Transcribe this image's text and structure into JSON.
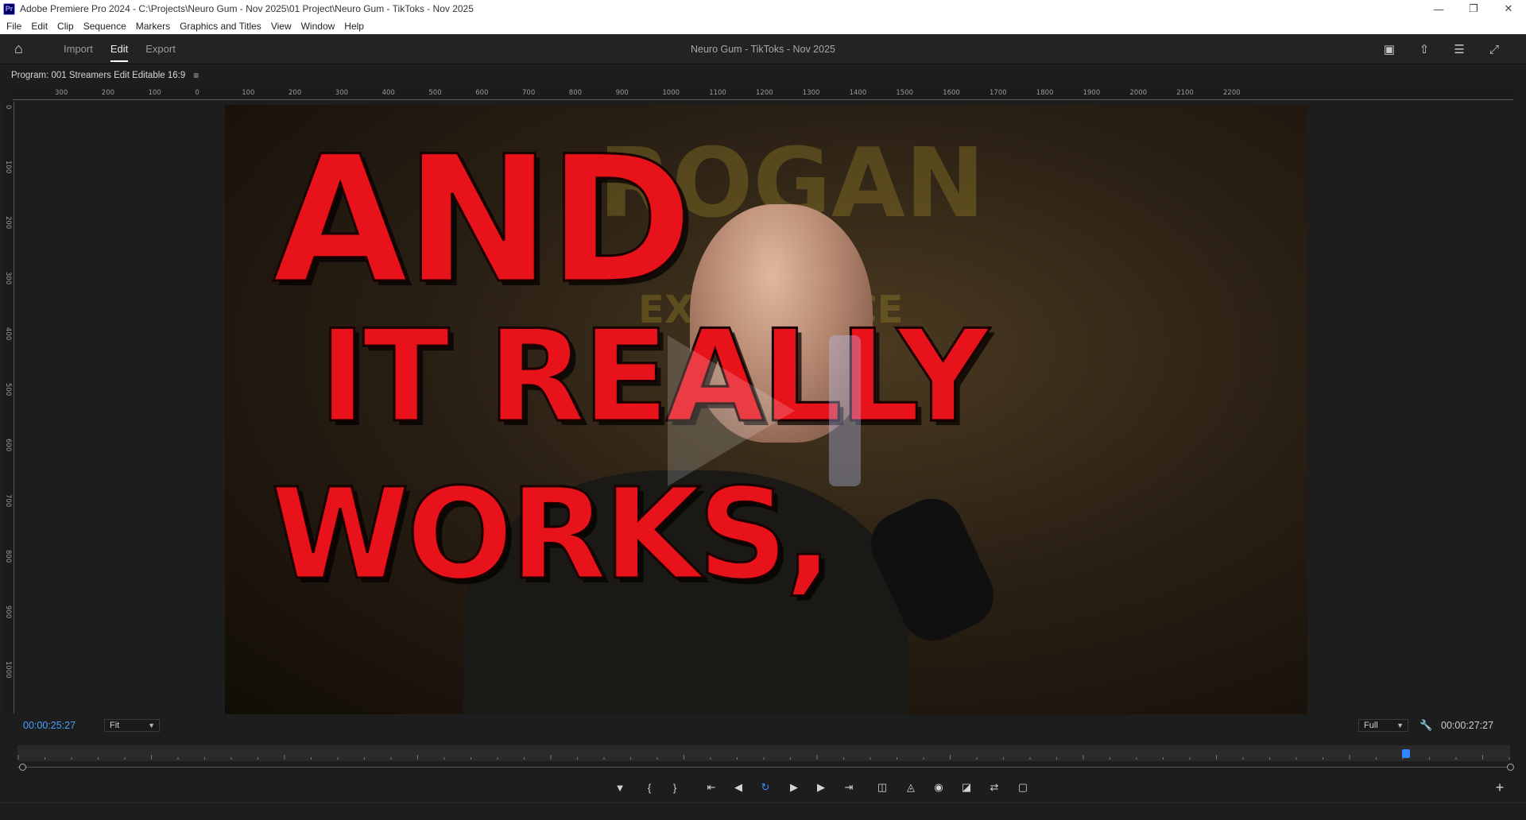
{
  "window": {
    "title": "Adobe Premiere Pro 2024 - C:\\Projects\\Neuro Gum - Nov 2025\\01 Project\\Neuro Gum - TikToks - Nov 2025",
    "logo": "Pr",
    "controls": [
      "minimize-icon",
      "restore-icon",
      "close-icon"
    ]
  },
  "menu": [
    "File",
    "Edit",
    "Clip",
    "Sequence",
    "Markers",
    "Graphics and Titles",
    "View",
    "Window",
    "Help"
  ],
  "appbar": {
    "home_icon": "home-icon",
    "tabs": [
      {
        "label": "Import",
        "active": false
      },
      {
        "label": "Edit",
        "active": true
      },
      {
        "label": "Export",
        "active": false
      }
    ],
    "project_title": "Neuro Gum - TikToks - Nov 2025",
    "right_icons": [
      "workspaces-icon",
      "share-icon",
      "panel-menu-icon",
      "fullscreen-icon"
    ]
  },
  "panel": {
    "title": "Program: 001 Streamers Edit Editable 16:9",
    "menu_icon": "hamburger-icon"
  },
  "ruler": {
    "h_labels": [
      "300",
      "200",
      "100",
      "0",
      "100",
      "200",
      "300",
      "400",
      "500",
      "600",
      "700",
      "800",
      "900",
      "1000",
      "1100",
      "1200",
      "1300",
      "1400",
      "1500",
      "1600",
      "1700",
      "1800",
      "1900",
      "2000",
      "2100",
      "2200"
    ],
    "v_labels": [
      "0",
      "100",
      "200",
      "300",
      "400",
      "500",
      "600",
      "700",
      "800",
      "900",
      "1000"
    ]
  },
  "video": {
    "overlay_lines": [
      "AND",
      "IT REALLY",
      "WORKS,"
    ],
    "background_words": [
      "ROGAN",
      "EXPERIENCE"
    ],
    "overlay_color": "#e8121a"
  },
  "timecode": {
    "current": "00:00:25:27",
    "zoom": "Fit",
    "resolution": "Full",
    "duration": "00:00:27:27",
    "playhead_fraction": 0.93,
    "accent": "#4aa0ff"
  },
  "transport": [
    {
      "icon": "add-marker-icon",
      "active": false
    },
    {
      "icon": "mark-in-icon",
      "active": false
    },
    {
      "icon": "mark-out-icon",
      "active": false
    },
    {
      "icon": "go-to-in-icon",
      "active": false
    },
    {
      "icon": "step-back-icon",
      "active": false
    },
    {
      "icon": "loop-icon",
      "active": true
    },
    {
      "icon": "play-icon",
      "active": false
    },
    {
      "icon": "step-forward-icon",
      "active": false
    },
    {
      "icon": "go-to-out-icon",
      "active": false
    },
    {
      "icon": "lift-icon",
      "active": false
    },
    {
      "icon": "extract-icon",
      "active": false
    },
    {
      "icon": "export-frame-icon",
      "active": false
    },
    {
      "icon": "comparison-view-icon",
      "active": false
    },
    {
      "icon": "vr-video-icon",
      "active": false
    },
    {
      "icon": "safe-margins-icon",
      "active": false
    },
    {
      "icon": "add-button-icon",
      "active": false
    }
  ]
}
